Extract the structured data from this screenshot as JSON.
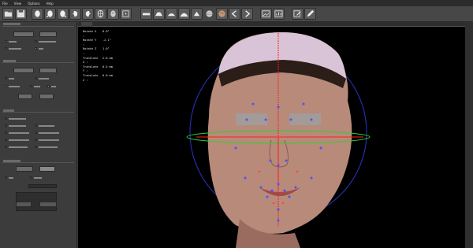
{
  "menu": {
    "items": [
      "File",
      "View",
      "Options",
      "Help"
    ]
  },
  "toolbar": {
    "icons": [
      "open-folder-icon",
      "save-icon",
      "face-front-icon",
      "face-rotate-left-icon",
      "face-rotate-right-icon",
      "face-side-left-icon",
      "face-side-right-icon",
      "face-mesh-icon",
      "face-texture-icon",
      "face-points-icon",
      "flat-view-icon",
      "perspective-view-icon",
      "arc-view-icon",
      "dome-view-icon",
      "shade-view-icon",
      "sphere-icon",
      "face-avatar-icon",
      "arrow-left-icon",
      "arrow-right-icon",
      "image-icon",
      "chart-icon",
      "edit-icon",
      "pen-icon"
    ]
  },
  "viewport": {
    "readout": [
      {
        "label": "Rotate X :",
        "value": "0.0°"
      },
      {
        "label": "Rotate Y :",
        "value": "-2.1°"
      },
      {
        "label": "Rotate Z :",
        "value": "1.0°"
      },
      {
        "label": "Translate X :",
        "value": "2.0 mm"
      },
      {
        "label": "Translate Y :",
        "value": "0.5 mm"
      },
      {
        "label": "Translate Z :",
        "value": "0.0 mm"
      }
    ]
  },
  "colors": {
    "accent_red": "#ff2020",
    "accent_green": "#2fd02f",
    "accent_blue": "#3040ff",
    "landmark": "#5050ff"
  }
}
